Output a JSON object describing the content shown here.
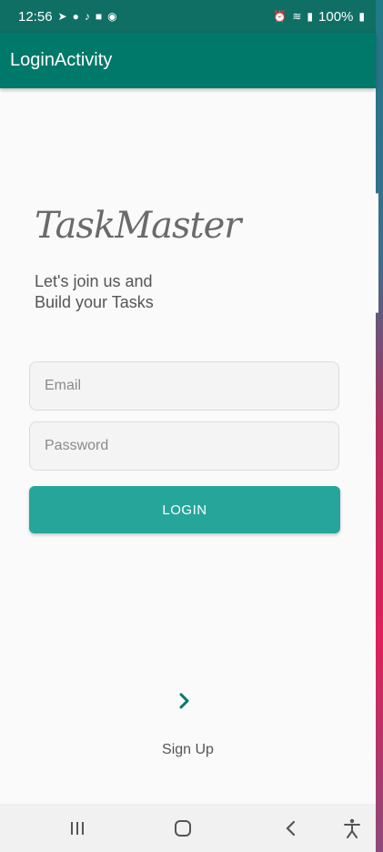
{
  "status_bar": {
    "time": "12:56",
    "battery": "100%",
    "left_icons": [
      "telegram-icon",
      "messenger-icon",
      "bell-icon",
      "notification-icon",
      "whatsapp-icon"
    ],
    "right_icons": [
      "alarm-icon",
      "wifi-icon",
      "signal-icon",
      "battery-icon"
    ]
  },
  "app_bar": {
    "title": "LoginActivity"
  },
  "logo": {
    "text": "TaskMaster"
  },
  "tagline": {
    "line1": "Let's join us and",
    "line2": "Build your Tasks"
  },
  "form": {
    "email_placeholder": "Email",
    "password_placeholder": "Password",
    "login_label": "LOGIN"
  },
  "signup": {
    "label": "Sign Up"
  },
  "nav_bar": {
    "buttons": [
      "recents-icon",
      "home-icon",
      "back-icon",
      "accessibility-icon"
    ]
  },
  "colors": {
    "primary": "#00796b",
    "status_bar": "#0f6f64",
    "accent": "#26a69a",
    "background": "#fafafa"
  }
}
